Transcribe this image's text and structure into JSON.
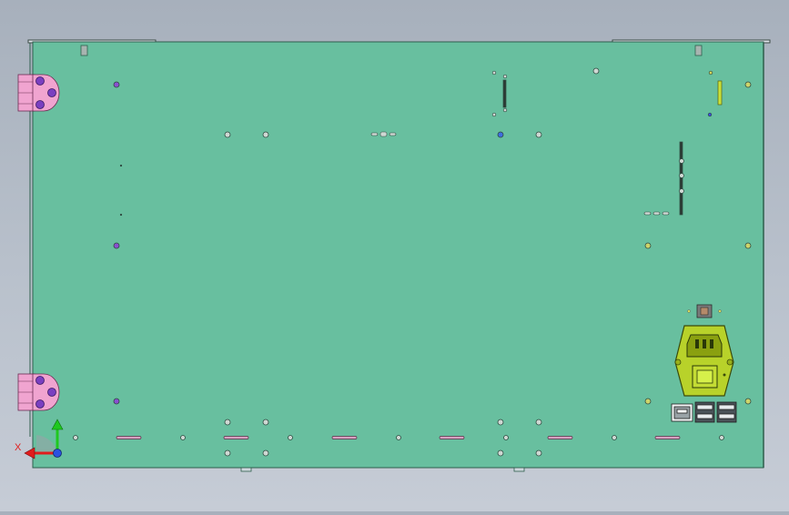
{
  "view": {
    "title": "",
    "background_top": "#a7b0bc",
    "background_bottom": "#c6ccd6"
  },
  "panel": {
    "fill": "#68bf9f",
    "edge": "#2e5e4c"
  },
  "hinges": {
    "color": "#f0a4d0",
    "count": 2
  },
  "power_inlet": {
    "color": "#b8d22a",
    "switch_color": "#d6f04a"
  },
  "ports": {
    "count": 3,
    "icon": "usb-port-icon"
  },
  "triad": {
    "x_label": "X",
    "x_color": "#e01c1c",
    "y_color": "#1fc81f",
    "origin_color": "#2a52e0"
  }
}
